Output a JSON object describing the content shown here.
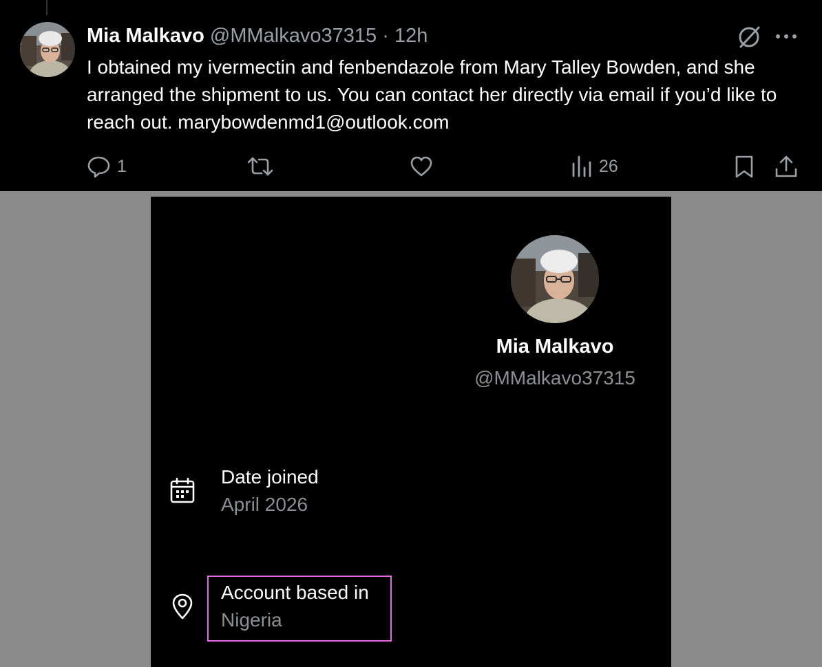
{
  "tweet": {
    "author_name": "Mia Malkavo",
    "handle": "@MMalkavo37315",
    "separator": "·",
    "time": "12h",
    "text": "I obtained my ivermectin and fenbendazole from Mary Talley Bowden, and she arranged the shipment to us. You can contact her directly via email if you’d like to reach out. marybowdenmd1@outlook.com",
    "actions": {
      "reply_count": "1",
      "retweet_count": "",
      "like_count": "",
      "views_count": "26"
    },
    "icons": [
      "grok-icon",
      "more-icon",
      "reply-icon",
      "retweet-icon",
      "like-icon",
      "views-icon",
      "bookmark-icon",
      "share-icon"
    ]
  },
  "profile_card": {
    "name": "Mia Malkavo",
    "handle": "@MMalkavo37315",
    "date_joined_label": "Date joined",
    "date_joined_value": "April 2026",
    "based_in_label": "Account based in",
    "based_in_value": "Nigeria",
    "highlight_color": "#e66ae6"
  }
}
